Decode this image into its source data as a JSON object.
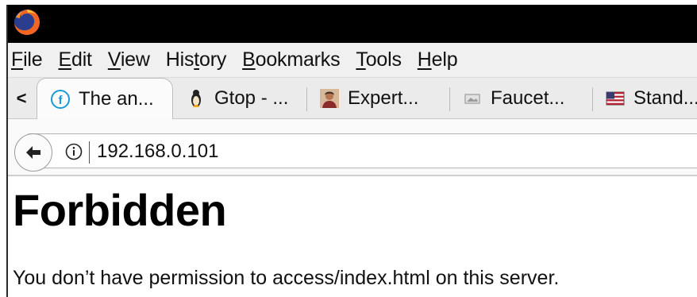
{
  "menu": {
    "items": [
      {
        "mnemonic": "F",
        "rest": "ile"
      },
      {
        "mnemonic": "E",
        "rest": "dit"
      },
      {
        "mnemonic": "V",
        "rest": "iew"
      },
      {
        "pre": "His",
        "mnemonic": "t",
        "rest": "ory"
      },
      {
        "mnemonic": "B",
        "rest": "ookmarks"
      },
      {
        "mnemonic": "T",
        "rest": "ools"
      },
      {
        "mnemonic": "H",
        "rest": "elp"
      }
    ]
  },
  "tabs": {
    "scroll_left_glyph": "<",
    "items": [
      {
        "label": "The an...",
        "icon": "faucet-site-icon",
        "active": true
      },
      {
        "label": "Gtop - ...",
        "icon": "gtop-figure-icon",
        "active": false
      },
      {
        "label": "Expert...",
        "icon": "expert-avatar-icon",
        "active": false
      },
      {
        "label": "Faucet...",
        "icon": "faucet-image-icon",
        "active": false
      },
      {
        "label": "Stand...",
        "icon": "flag-icon",
        "active": false
      }
    ]
  },
  "navigation": {
    "url": "192.168.0.101"
  },
  "page": {
    "heading": "Forbidden",
    "message": "You don’t have permission to access/index.html on this server."
  },
  "colors": {
    "titlebar": "#000000",
    "menubar": "#f0f0f0",
    "tabstrip": "#ebebeb",
    "firefox_orange": "#f26522",
    "firefox_blue": "#2b3d8f"
  }
}
